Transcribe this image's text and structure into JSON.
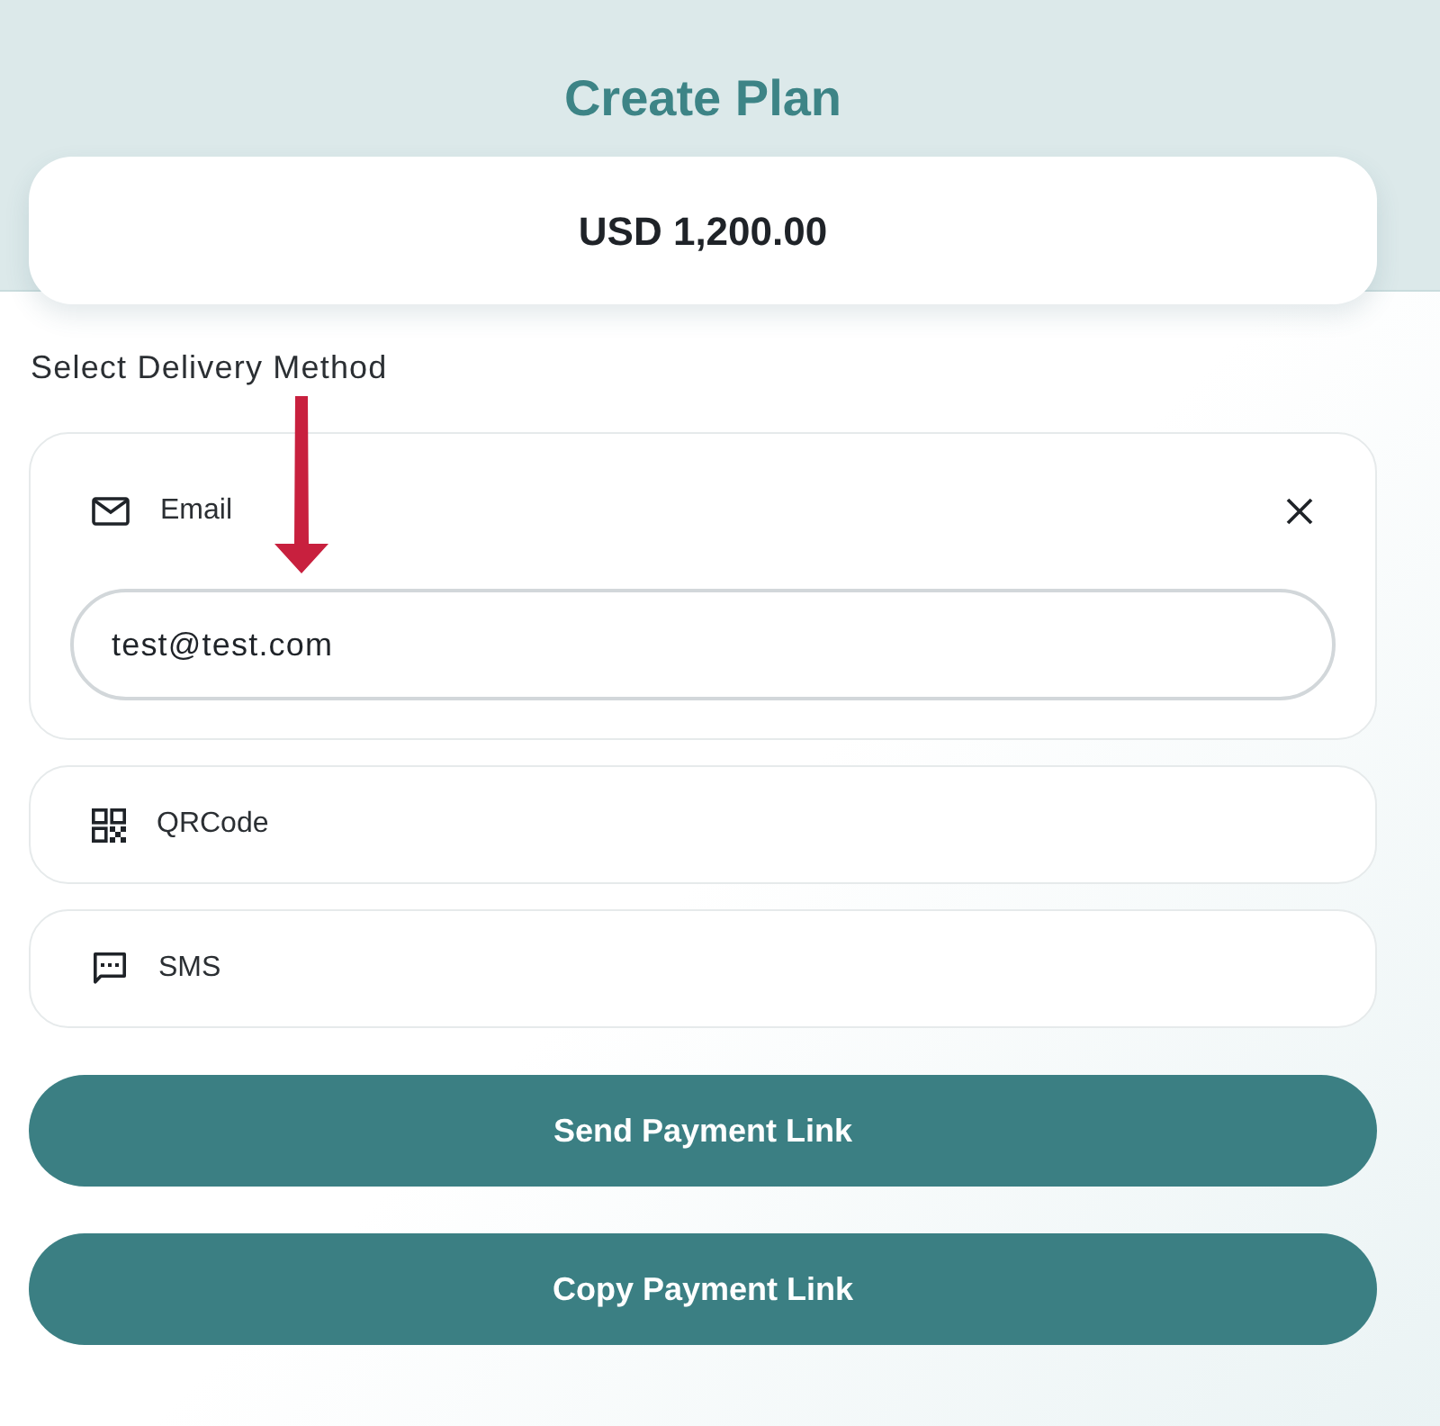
{
  "page": {
    "title": "Create Plan"
  },
  "amount": {
    "text": "USD 1,200.00"
  },
  "delivery": {
    "label": "Select Delivery Method",
    "methods": [
      {
        "kind": "email",
        "label": "Email",
        "expanded": true,
        "input": {
          "value": "test@test.com"
        }
      },
      {
        "kind": "qrcode",
        "label": "QRCode",
        "expanded": false
      },
      {
        "kind": "sms",
        "label": "SMS",
        "expanded": false
      }
    ]
  },
  "buttons": [
    {
      "label": "Send Payment Link"
    },
    {
      "label": "Copy Payment Link"
    }
  ]
}
